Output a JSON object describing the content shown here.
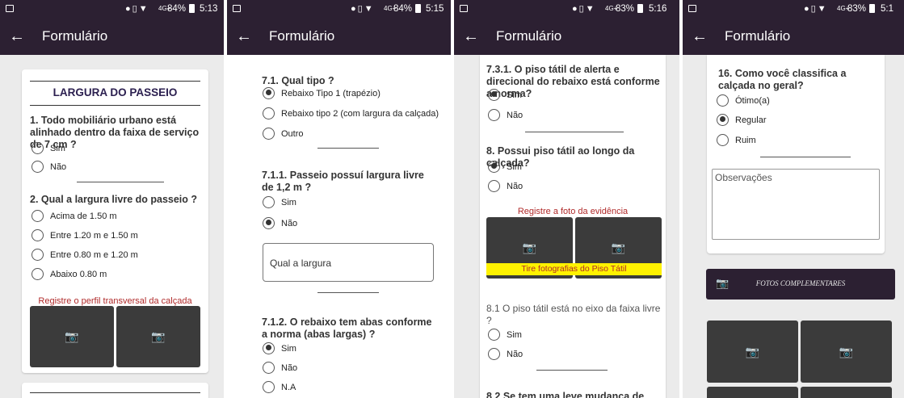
{
  "status": [
    {
      "battery": "84%",
      "time": "5:13"
    },
    {
      "battery": "84%",
      "time": "5:15"
    },
    {
      "battery": "83%",
      "time": "5:16"
    },
    {
      "battery": "83%",
      "time": "5:1"
    }
  ],
  "network": "4G+",
  "app_title": "Formulário",
  "screen1": {
    "section_title": "LARGURA DO PASSEIO",
    "q1": "1. Todo mobiliário urbano está alinhado dentro da faixa de serviço de 7 cm ?",
    "q1_opts": [
      "Sim",
      "Não"
    ],
    "q2": "2. Qual a largura livre do passeio ?",
    "q2_opts": [
      "Acima de 1.50 m",
      "Entre 1.20 m e 1.50 m",
      "Entre 0.80 m e 1.20 m",
      "Abaixo 0.80 m"
    ],
    "photo_caption": "Registre o perfil transversal da calçada"
  },
  "screen2": {
    "q71": "7.1. Qual tipo ?",
    "q71_opts": [
      "Rebaixo Tipo 1 (trapézio)",
      "Rebaixo tipo 2 (com largura da calçada)",
      "Outro"
    ],
    "q711": "7.1.1. Passeio possuí largura livre de 1,2 m ?",
    "q711_opts": [
      "Sim",
      "Não"
    ],
    "width_placeholder": "Qual a largura",
    "q712": "7.1.2. O rebaixo tem abas conforme a norma (abas largas) ?",
    "q712_opts": [
      "Sim",
      "Não",
      "N.A"
    ]
  },
  "screen3": {
    "q731": "7.3.1. O piso tátil de alerta e direcional do rebaixo está conforme a norma?",
    "q731_opts": [
      "Sim",
      "Não"
    ],
    "q8": "8. Possui piso tátil ao longo da calçada?",
    "q8_opts": [
      "Sim",
      "Não"
    ],
    "evidence_caption": "Registre a foto da evidência",
    "photo_bar": "Tire fotografias do Piso Tátil",
    "q81": "8.1 O piso tátil está no eixo da faixa livre ?",
    "q81_opts": [
      "Sim",
      "Não"
    ],
    "q82": "8.2 Se tem uma leve mudança de"
  },
  "screen4": {
    "q16": "16. Como você classifica a calçada no geral?",
    "q16_opts": [
      "Ótimo(a)",
      "Regular",
      "Ruim"
    ],
    "obs_placeholder": "Observações",
    "extra_photos": "FOTOS COMPLEMENTARES"
  },
  "colors": {
    "appbar": "#2c2032",
    "caption_red": "#b02a2a",
    "highlight_yellow": "#fff200",
    "photo_tile": "#3b3b3b"
  }
}
